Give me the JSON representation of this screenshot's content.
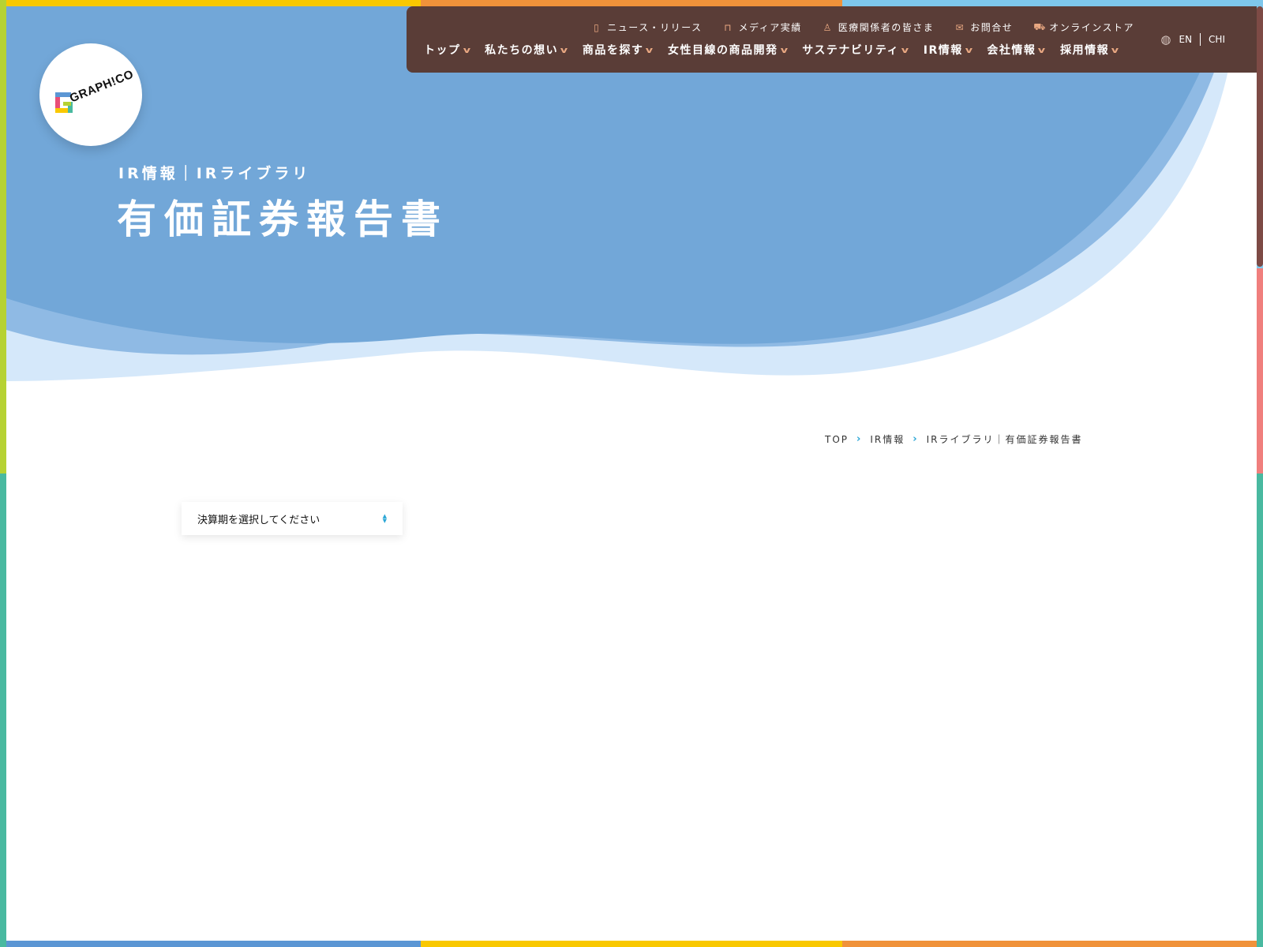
{
  "colors": {
    "hero_blue": "#72a7d8",
    "hero_mid": "#8fbae4",
    "hero_light": "#d5e8fa",
    "nav_brown": "#5a3d37",
    "accent_orange": "#e9a882",
    "accent_cyan": "#2aa6d6",
    "frame_yellow": "#f9c800",
    "frame_orange": "#f0923a",
    "frame_skyblue": "#7ec7ec",
    "frame_green": "#b6d233",
    "frame_teal": "#49b9a0",
    "frame_red": "#f07f7d",
    "frame_blue": "#5b96d4"
  },
  "logo": {
    "text": "GRAPH!CO"
  },
  "header": {
    "utility_links": [
      {
        "label": "ニュース・リリース",
        "icon": "document-icon"
      },
      {
        "label": "メディア実績",
        "icon": "book-icon"
      },
      {
        "label": "医療関係者の皆さま",
        "icon": "person-icon"
      },
      {
        "label": "お問合せ",
        "icon": "mail-icon"
      },
      {
        "label": "オンラインストア",
        "icon": "cart-icon"
      }
    ],
    "main_nav": [
      {
        "label": "トップ"
      },
      {
        "label": "私たちの想い"
      },
      {
        "label": "商品を探す"
      },
      {
        "label": "女性目線の商品開発"
      },
      {
        "label": "サステナビリティ"
      },
      {
        "label": "IR情報"
      },
      {
        "label": "会社情報"
      },
      {
        "label": "採用情報"
      }
    ],
    "languages": {
      "en": "EN",
      "chi": "CHI",
      "icon": "globe-icon"
    }
  },
  "hero": {
    "subtitle": "IR情報｜IRライブラリ",
    "title": "有価証券報告書"
  },
  "breadcrumb": {
    "items": [
      "TOP",
      "IR情報",
      "IRライブラリ｜有価証券報告書"
    ]
  },
  "filter": {
    "select_label": "決算期を選択してください"
  }
}
